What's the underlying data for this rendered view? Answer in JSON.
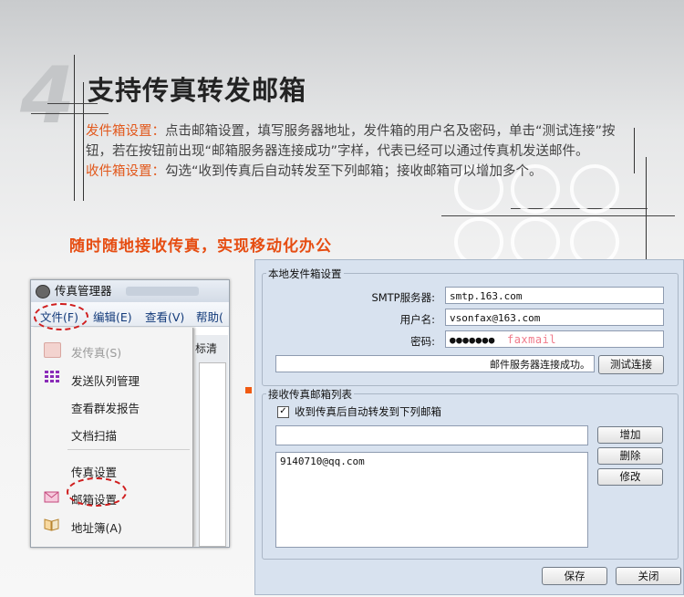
{
  "section": {
    "number": "4",
    "title": "支持传真转发邮箱"
  },
  "paragraph": {
    "outbox_label": "发件箱设置：",
    "outbox_text": "点击邮箱设置，填写服务器地址，发件箱的用户名及密码，单击“测试连接”按钮，若在按钮前出现“邮箱服务器连接成功”字样，代表已经可以通过传真机发送邮件。",
    "inbox_label": "收件箱设置：",
    "inbox_text": "勾选“收到传真后自动转发至下列邮箱；接收邮箱可以增加多个。"
  },
  "slogan": "随时随地接收传真，实现移动化办公",
  "fax_manager": {
    "window_title": "传真管理器",
    "menu": [
      "文件(F)",
      "编辑(E)",
      "查看(V)",
      "帮助("
    ],
    "partial_column": "标清",
    "dropdown": {
      "send_fax": "发传真(S)",
      "send_queue": "发送队列管理",
      "group_report": "查看群发报告",
      "doc_scan": "文档扫描",
      "fax_settings": "传真设置",
      "mail_settings": "邮箱设置",
      "address_book": "地址簿(A)"
    }
  },
  "mail_dialog": {
    "outbox_group": "本地发件箱设置",
    "smtp_label": "SMTP服务器:",
    "smtp_value": "smtp.163.com",
    "user_label": "用户名:",
    "user_value": "vsonfax@163.com",
    "pwd_label": "密码:",
    "pwd_value": "●●●●●●●",
    "pwd_hint": "faxmail",
    "status": "邮件服务器连接成功。",
    "test_button": "测试连接",
    "inbox_group": "接收传真邮箱列表",
    "forward_checkbox": "收到传真后自动转发到下列邮箱",
    "forward_checked": true,
    "email_list": [
      "9140710@qq.com"
    ],
    "add_button": "增加",
    "delete_button": "删除",
    "edit_button": "修改",
    "save_button": "保存",
    "close_button": "关闭"
  },
  "colors": {
    "accent_orange": "#e64d12",
    "label_orange": "#e2581b",
    "highlight_red": "#d01e1e",
    "dialog_bg": "#d8e2ef"
  }
}
